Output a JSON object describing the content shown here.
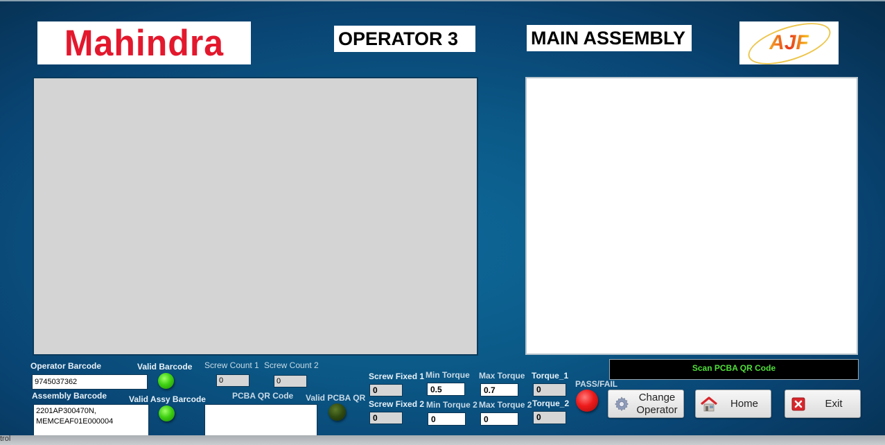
{
  "header": {
    "logo_left": "Mahindra",
    "logo_right": "AJF",
    "operator_title": "OPERATOR 3",
    "station_title": "MAIN ASSEMBLY"
  },
  "inputs": {
    "operator_barcode": {
      "label": "Operator Barcode",
      "value": "9745037362"
    },
    "assembly_barcode": {
      "label": "Assembly Barcode",
      "value": "2201AP300470N,\nMEMCEAF01E000004"
    },
    "pcba_qr": {
      "label": "PCBA QR Code",
      "value": ""
    }
  },
  "indicators": {
    "valid_barcode": {
      "label": "Valid Barcode",
      "state": "on",
      "color": "#3fd012"
    },
    "valid_assy_barcode": {
      "label": "Valid Assy Barcode",
      "state": "on",
      "color": "#3fd012"
    },
    "valid_pcba_qr": {
      "label": "Valid PCBA QR",
      "state": "off",
      "color": "#2f4a10"
    },
    "pass_fail": {
      "label": "PASS/FAIL",
      "state": "fail",
      "color": "#ee1b1b"
    }
  },
  "counters": {
    "screw_count_1": {
      "label": "Screw Count 1",
      "value": "0"
    },
    "screw_count_2": {
      "label": "Screw Count 2",
      "value": "0"
    },
    "screw_fixed_1": {
      "label": "Screw Fixed 1",
      "value": "0"
    },
    "screw_fixed_2": {
      "label": "Screw Fixed 2",
      "value": "0"
    }
  },
  "torque": {
    "min_torque": {
      "label": "Min Torque",
      "value": "0.5"
    },
    "max_torque": {
      "label": "Max Torque",
      "value": "0.7"
    },
    "torque_1": {
      "label": "Torque_1",
      "value": "0"
    },
    "min_torque_2": {
      "label": "Min Torque 2",
      "value": "0"
    },
    "max_torque_2": {
      "label": "Max Torque 2",
      "value": "0"
    },
    "torque_2": {
      "label": "Torque_2",
      "value": "0"
    }
  },
  "status": {
    "message": "Scan PCBA QR Code",
    "color": "#4fe03a"
  },
  "buttons": {
    "change_operator": {
      "label_line1": "Change",
      "label_line2": "Operator",
      "icon": "gear-icon"
    },
    "home": {
      "label": "Home",
      "icon": "home-icon"
    },
    "exit": {
      "label": "Exit",
      "icon": "close-box-icon"
    }
  },
  "statusbar": {
    "text": "trol"
  }
}
